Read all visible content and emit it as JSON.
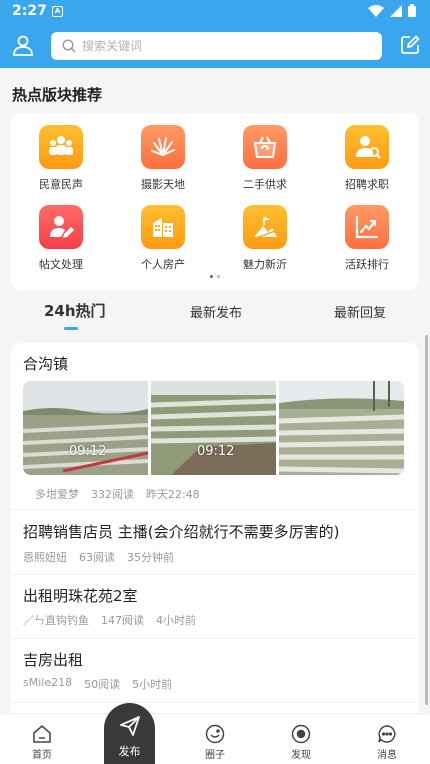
{
  "status_bar": {
    "time": "2:27",
    "app_icon": "A"
  },
  "search": {
    "placeholder": "搜索关键词"
  },
  "icons": {
    "profile": "person-outline-icon",
    "search": "search-icon",
    "edit": "edit-square-icon"
  },
  "hot_section": {
    "title": "热点版块推荐",
    "categories": [
      {
        "label": "民意民声",
        "icon": "people-group-icon",
        "color": "#ffab1f"
      },
      {
        "label": "摄影天地",
        "icon": "camera-shutter-icon",
        "color": "#ff8a55"
      },
      {
        "label": "二手供求",
        "icon": "recycle-basket-icon",
        "color": "#ff7a48"
      },
      {
        "label": "招聘求职",
        "icon": "recruit-person-icon",
        "color": "#ffab1f"
      },
      {
        "label": "帖文处理",
        "icon": "person-edit-icon",
        "color": "#f5484d"
      },
      {
        "label": "个人房产",
        "icon": "building-icon",
        "color": "#ffab1f"
      },
      {
        "label": "魅力新沂",
        "icon": "landscape-flag-icon",
        "color": "#ffab1f"
      },
      {
        "label": "活跃排行",
        "icon": "trend-chart-icon",
        "color": "#ff7a48"
      }
    ]
  },
  "tabs": [
    {
      "label": "24h热门",
      "active": true
    },
    {
      "label": "最新发布",
      "active": false
    },
    {
      "label": "最新回复",
      "active": false
    }
  ],
  "posts": [
    {
      "title": "合沟镇",
      "author": "多坩爱梦",
      "reads": "332阅读",
      "time": "昨天22:48",
      "thumbs": [
        {
          "timestamp": "09:12"
        },
        {
          "timestamp": "09:12"
        },
        {
          "timestamp": ""
        }
      ]
    },
    {
      "title": "招聘销售店员 主播(会介绍就行不需要多厉害的)",
      "author": "恩熙妞妞",
      "reads": "63阅读",
      "time": "35分钟前"
    },
    {
      "title": "出租明珠花苑2室",
      "author": "／ㄣ直钩钓鱼",
      "reads": "147阅读",
      "time": "4小时前"
    },
    {
      "title": "吉房出租",
      "author": "sMile218",
      "reads": "50阅读",
      "time": "5小时前"
    }
  ],
  "bottom_nav": [
    {
      "label": "首页",
      "icon": "home-icon"
    },
    {
      "label": "发布",
      "icon": "paper-plane-icon"
    },
    {
      "label": "圈子",
      "icon": "circle-smile-icon"
    },
    {
      "label": "发现",
      "icon": "compass-target-icon"
    },
    {
      "label": "消息",
      "icon": "chat-bubble-icon"
    }
  ],
  "colors": {
    "header": "#3aa6ee",
    "accent": "#3aa6ee",
    "publish": "#3a3a3a"
  }
}
